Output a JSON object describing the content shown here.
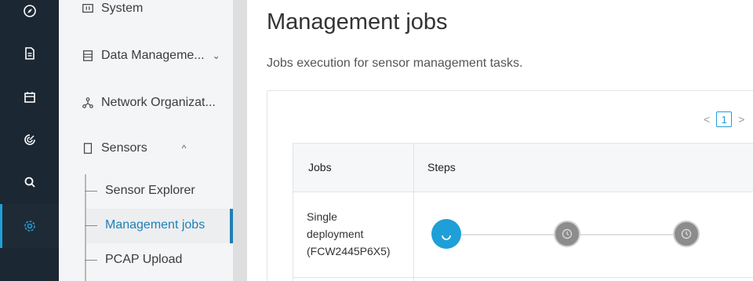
{
  "rail": {
    "items": [
      {
        "icon": "compass-icon"
      },
      {
        "icon": "document-icon"
      },
      {
        "icon": "calendar-icon"
      },
      {
        "icon": "radar-icon"
      },
      {
        "icon": "search-icon"
      },
      {
        "icon": "gear-icon",
        "active": true
      }
    ]
  },
  "sidebar": {
    "items": [
      {
        "label": "System",
        "icon": "system-icon"
      },
      {
        "label": "Data Manageme...",
        "icon": "data-icon",
        "chevron": "⌄"
      },
      {
        "label": "Network Organizat...",
        "icon": "network-icon"
      },
      {
        "label": "Sensors",
        "icon": "sensor-icon",
        "chevron": "^"
      }
    ],
    "sub_items": [
      {
        "label": "Sensor Explorer"
      },
      {
        "label": "Management jobs",
        "active": true
      },
      {
        "label": "PCAP Upload"
      }
    ]
  },
  "main": {
    "title": "Management jobs",
    "subtitle": "Jobs execution for sensor management tasks.",
    "pager": {
      "prev": "<",
      "page": "1",
      "next": ">"
    },
    "table": {
      "headers": [
        "Jobs",
        "Steps"
      ],
      "rows": [
        {
          "job_line1": "Single",
          "job_line2": "deployment",
          "job_line3": "(FCW2445P6X5)"
        }
      ]
    }
  },
  "colors": {
    "accent": "#1e9fd8",
    "rail_bg": "#1b2733",
    "pending": "#8c8c8c"
  }
}
